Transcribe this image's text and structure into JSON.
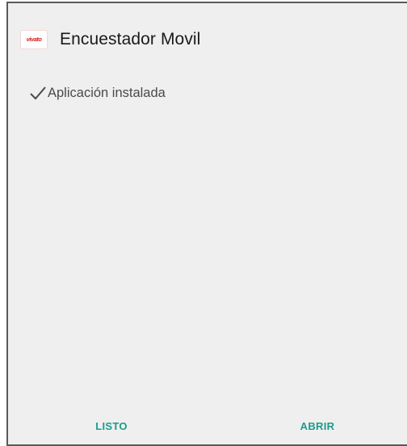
{
  "app": {
    "title": "Encuestador Movil",
    "logo_text": "vivato",
    "logo_icon": "app-logo-icon"
  },
  "status": {
    "text": "Aplicación instalada",
    "icon": "check-icon"
  },
  "actions": {
    "done_label": "LISTO",
    "open_label": "ABRIR"
  },
  "colors": {
    "background": "#efefef",
    "button_text": "#1f9a8c",
    "title_text": "#1a1a1a",
    "status_text": "#4a4a4a",
    "logo_red": "#d42020"
  }
}
